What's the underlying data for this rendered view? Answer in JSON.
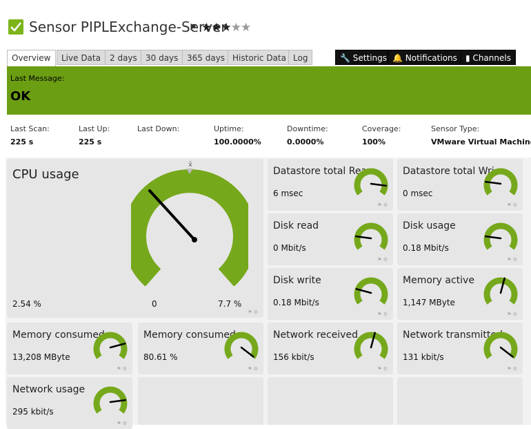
{
  "header": {
    "title": "Sensor PIPLExchange-Server",
    "flag_icon": "flag-icon",
    "priority_stars_on": "★★★",
    "priority_stars_off": "★★"
  },
  "tabs": {
    "overview": "Overview",
    "live_data": "Live Data",
    "two_days": "2 days",
    "thirty_days": "30 days",
    "year": "365 days",
    "historic": "Historic Data",
    "log": "Log",
    "settings": "Settings",
    "notifications": "Notifications",
    "channels": "Channels"
  },
  "message": {
    "label": "Last Message:",
    "value": "OK"
  },
  "stats": {
    "last_scan": {
      "label": "Last Scan:",
      "value": "225 s"
    },
    "last_up": {
      "label": "Last Up:",
      "value": "225 s"
    },
    "last_down": {
      "label": "Last Down:",
      "value": ""
    },
    "uptime": {
      "label": "Uptime:",
      "value": "100.0000%"
    },
    "downtime": {
      "label": "Downtime:",
      "value": "0.0000%"
    },
    "coverage": {
      "label": "Coverage:",
      "value": "100%"
    },
    "sensor_type": {
      "label": "Sensor Type:",
      "value": "VMware Virtual Machine (S"
    }
  },
  "cpu": {
    "name": "CPU usage",
    "value": "2.54 %",
    "min": "0",
    "max": "7.7 %",
    "x_marker": "x̄"
  },
  "channels": [
    {
      "name": "Datastore total Rea...",
      "value": "6 msec"
    },
    {
      "name": "Datastore total Wri...",
      "value": "0 msec"
    },
    {
      "name": "Disk read",
      "value": "0 Mbit/s"
    },
    {
      "name": "Disk usage",
      "value": "0.18 Mbit/s"
    },
    {
      "name": "Disk write",
      "value": "0.18 Mbit/s"
    },
    {
      "name": "Memory active",
      "value": "1,147 MByte"
    },
    {
      "name": "Memory consumed",
      "value": "13,208 MByte"
    },
    {
      "name": "Memory consumed...",
      "value": "80.61 %"
    },
    {
      "name": "Network received",
      "value": "156 kbit/s"
    },
    {
      "name": "Network transmitted",
      "value": "131 kbit/s"
    },
    {
      "name": "Network usage",
      "value": "295 kbit/s"
    }
  ],
  "colors": {
    "accent": "#7cb41a",
    "status_bar": "#6c9e14",
    "gauge": "#76a81c"
  }
}
